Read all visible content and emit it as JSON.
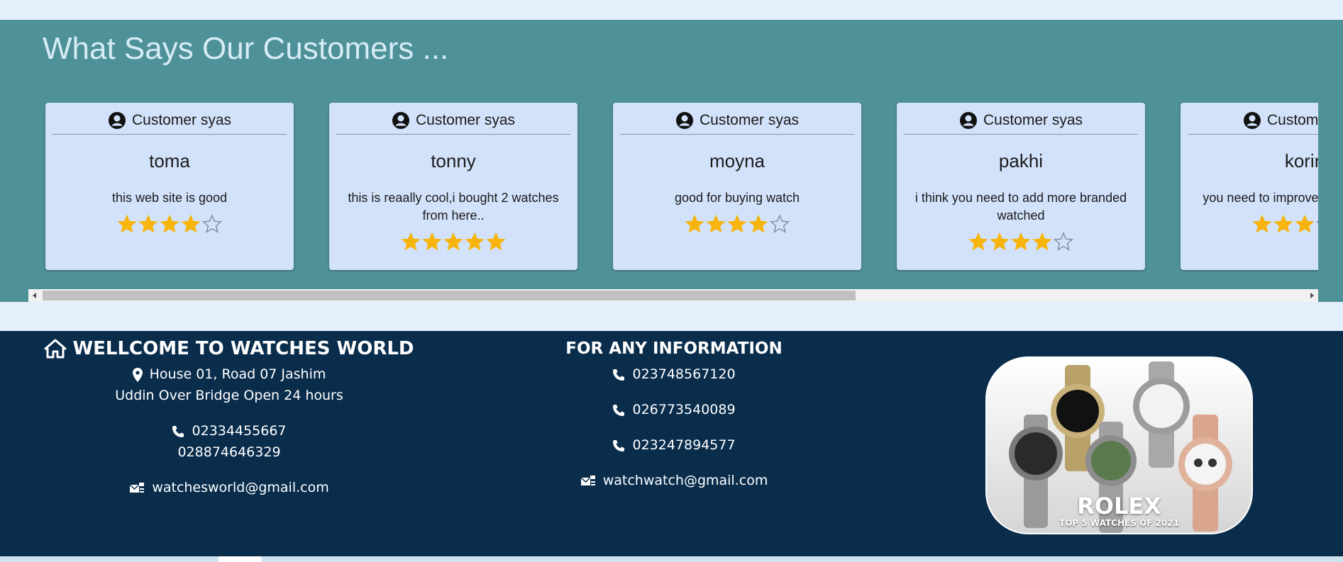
{
  "reviews": {
    "title": "What Says Our Customers ...",
    "cards": [
      {
        "heading": "Customer syas",
        "name": "toma",
        "text": "this web site is good",
        "rating": 4
      },
      {
        "heading": "Customer syas",
        "name": "tonny",
        "text": "this is reaally cool,i bought 2 watches from here..",
        "rating": 5
      },
      {
        "heading": "Customer syas",
        "name": "moyna",
        "text": "good for buying watch",
        "rating": 4
      },
      {
        "heading": "Customer syas",
        "name": "pakhi",
        "text": "i think you need to add more branded watched",
        "rating": 4
      },
      {
        "heading": "Customer syas",
        "name": "korin",
        "text": "you need to improve collections god",
        "rating": 3
      }
    ],
    "scroll_position": 0
  },
  "footer": {
    "col1": {
      "title": "WELLCOME TO WATCHES WORLD",
      "address_line1": "House 01, Road 07 Jashim",
      "address_line2": "Uddin Over Bridge Open 24 hours",
      "phone1": "02334455667",
      "phone2": "028874646329",
      "email": "watchesworld@gmail.com"
    },
    "col2": {
      "title": "FOR ANY INFORMATION",
      "phones": [
        "023748567120",
        "026773540089",
        "023247894577"
      ],
      "email": "watchwatch@gmail.com"
    },
    "promo": {
      "brand": "ROLEX",
      "subtitle": "TOP 5 WATCHES OF 2021"
    }
  },
  "colors": {
    "reviews_bg": "#4f9198",
    "card_bg": "#d3e2fb",
    "star": "#f7b40c",
    "footer_bg": "#0a2d4c",
    "page_bg": "#e3effa"
  },
  "icons": {
    "card_icon": "user-circle-icon",
    "filled_star": "star-filled-icon",
    "empty_star": "star-outline-icon",
    "home": "home-icon",
    "location": "map-pin-icon",
    "phone": "phone-icon",
    "email": "mail-icon"
  }
}
